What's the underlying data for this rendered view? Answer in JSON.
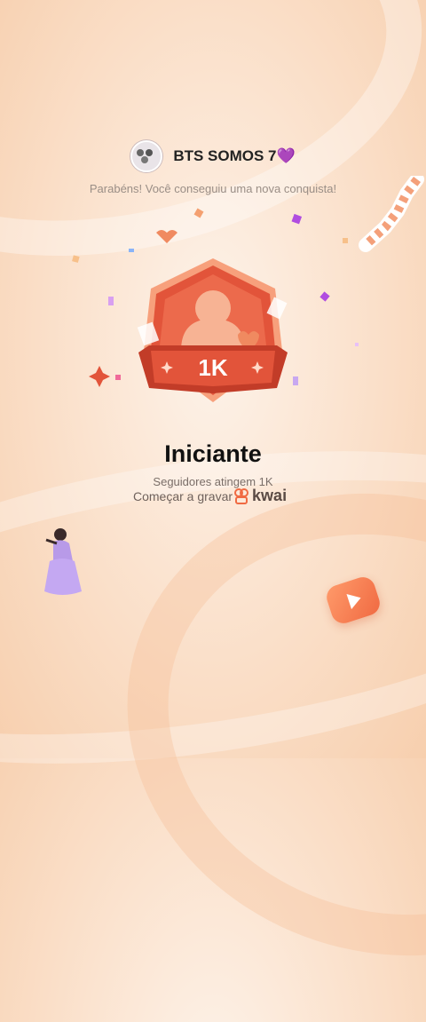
{
  "header": {
    "username": "BTS SOMOS 7💜",
    "subtitle": "Parabéns! Você conseguiu uma nova conquista!"
  },
  "badge": {
    "label": "1K",
    "icon": "user-badge-icon"
  },
  "achievement": {
    "title": "Iniciante",
    "description": "Seguidores atingem 1K",
    "cta": "Começar a gravar",
    "brand": "kwai"
  },
  "colors": {
    "badge_primary": "#e2543a",
    "badge_dark": "#c23c28",
    "badge_light": "#f7a07c",
    "text_dark": "#111111",
    "accent_purple": "#b04de0"
  }
}
